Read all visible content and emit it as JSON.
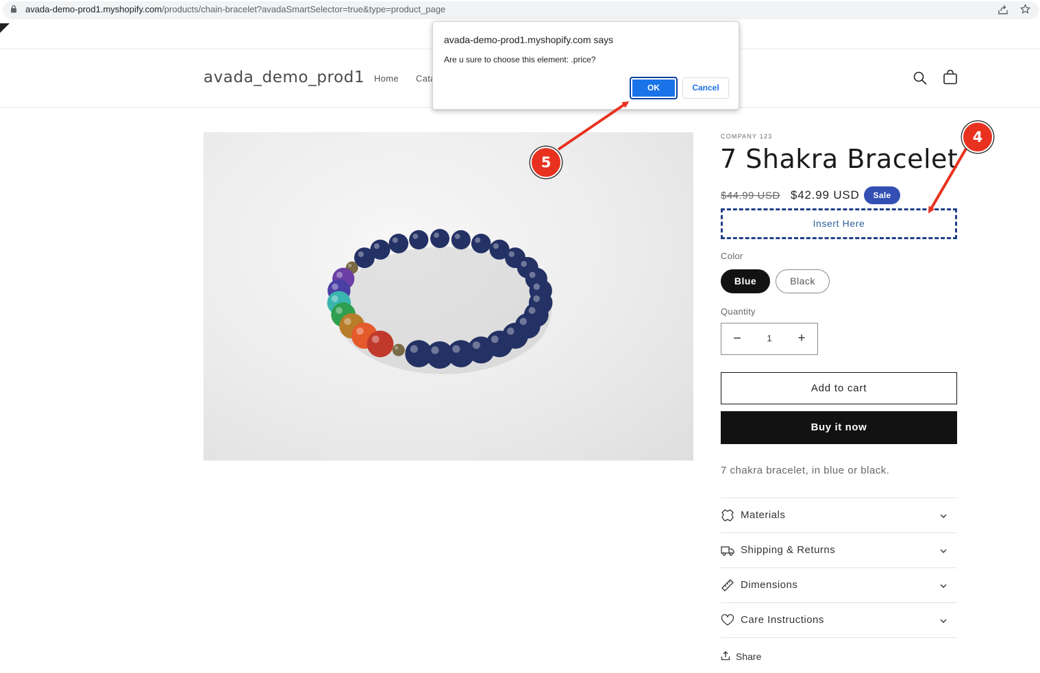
{
  "browser": {
    "url_host": "avada-demo-prod1.myshopify.com",
    "url_path": "/products/chain-bracelet?avadaSmartSelector=true&type=product_page"
  },
  "header": {
    "logo": "avada_demo_prod1",
    "nav": {
      "home": "Home",
      "catalog_partial": "Cata"
    }
  },
  "product": {
    "vendor": "COMPANY 123",
    "title": "7 Shakra Bracelet",
    "price_old": "$44.99 USD",
    "price_new": "$42.99 USD",
    "sale_badge": "Sale",
    "insert_placeholder": "Insert Here",
    "color_label": "Color",
    "colors": [
      "Blue",
      "Black"
    ],
    "selected_color": "Blue",
    "quantity_label": "Quantity",
    "quantity_value": "1",
    "quantity_minus": "−",
    "quantity_plus": "+",
    "add_to_cart": "Add to cart",
    "buy_now": "Buy it now",
    "description": "7 chakra bracelet, in blue or black.",
    "accordions": [
      {
        "label": "Materials",
        "icon": "leather-icon"
      },
      {
        "label": "Shipping & Returns",
        "icon": "truck-icon"
      },
      {
        "label": "Dimensions",
        "icon": "ruler-icon"
      },
      {
        "label": "Care Instructions",
        "icon": "heart-icon"
      }
    ],
    "share": "Share"
  },
  "dialog": {
    "title": "avada-demo-prod1.myshopify.com says",
    "message": "Are u sure to choose this element: .price?",
    "ok": "OK",
    "cancel": "Cancel"
  },
  "annotations": {
    "step_4": "4",
    "step_5": "5",
    "color": "#e8321f"
  },
  "colors": {
    "sale_badge": "#334fb4",
    "buy_now_bg": "#121212",
    "dialog_ok": "#1a73e8",
    "insert_border": "#1f3f86"
  }
}
